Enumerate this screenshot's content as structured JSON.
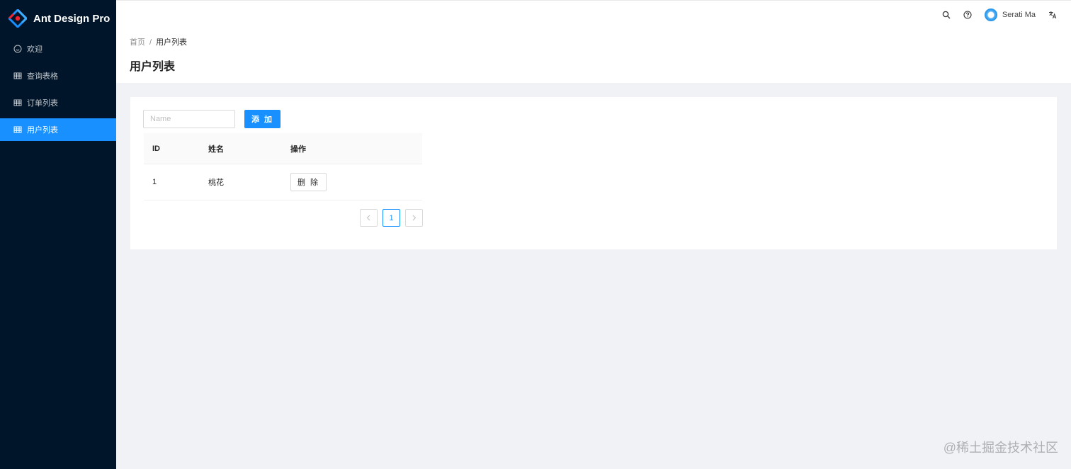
{
  "app": {
    "title": "Ant Design Pro",
    "accent_color": "#1890ff",
    "sider_color": "#001529"
  },
  "sidebar": {
    "items": [
      {
        "label": "欢迎",
        "icon": "smile-icon",
        "active": false
      },
      {
        "label": "查询表格",
        "icon": "table-icon",
        "active": false
      },
      {
        "label": "订单列表",
        "icon": "table-icon",
        "active": false
      },
      {
        "label": "用户列表",
        "icon": "table-icon",
        "active": true
      }
    ]
  },
  "header": {
    "search_icon": "search-icon",
    "help_icon": "question-circle-icon",
    "username": "Serati Ma",
    "language_icon": "translation-icon"
  },
  "breadcrumb": {
    "home": "首页",
    "separator": "/",
    "current": "用户列表"
  },
  "page": {
    "title": "用户列表"
  },
  "toolbar": {
    "name_placeholder": "Name",
    "name_value": "",
    "add_label": "添 加"
  },
  "table": {
    "columns": [
      "ID",
      "姓名",
      "操作"
    ],
    "rows": [
      {
        "id": "1",
        "name": "桃花",
        "action_label": "删 除"
      }
    ]
  },
  "pagination": {
    "current_page": "1"
  },
  "watermark": "@稀土掘金技术社区"
}
